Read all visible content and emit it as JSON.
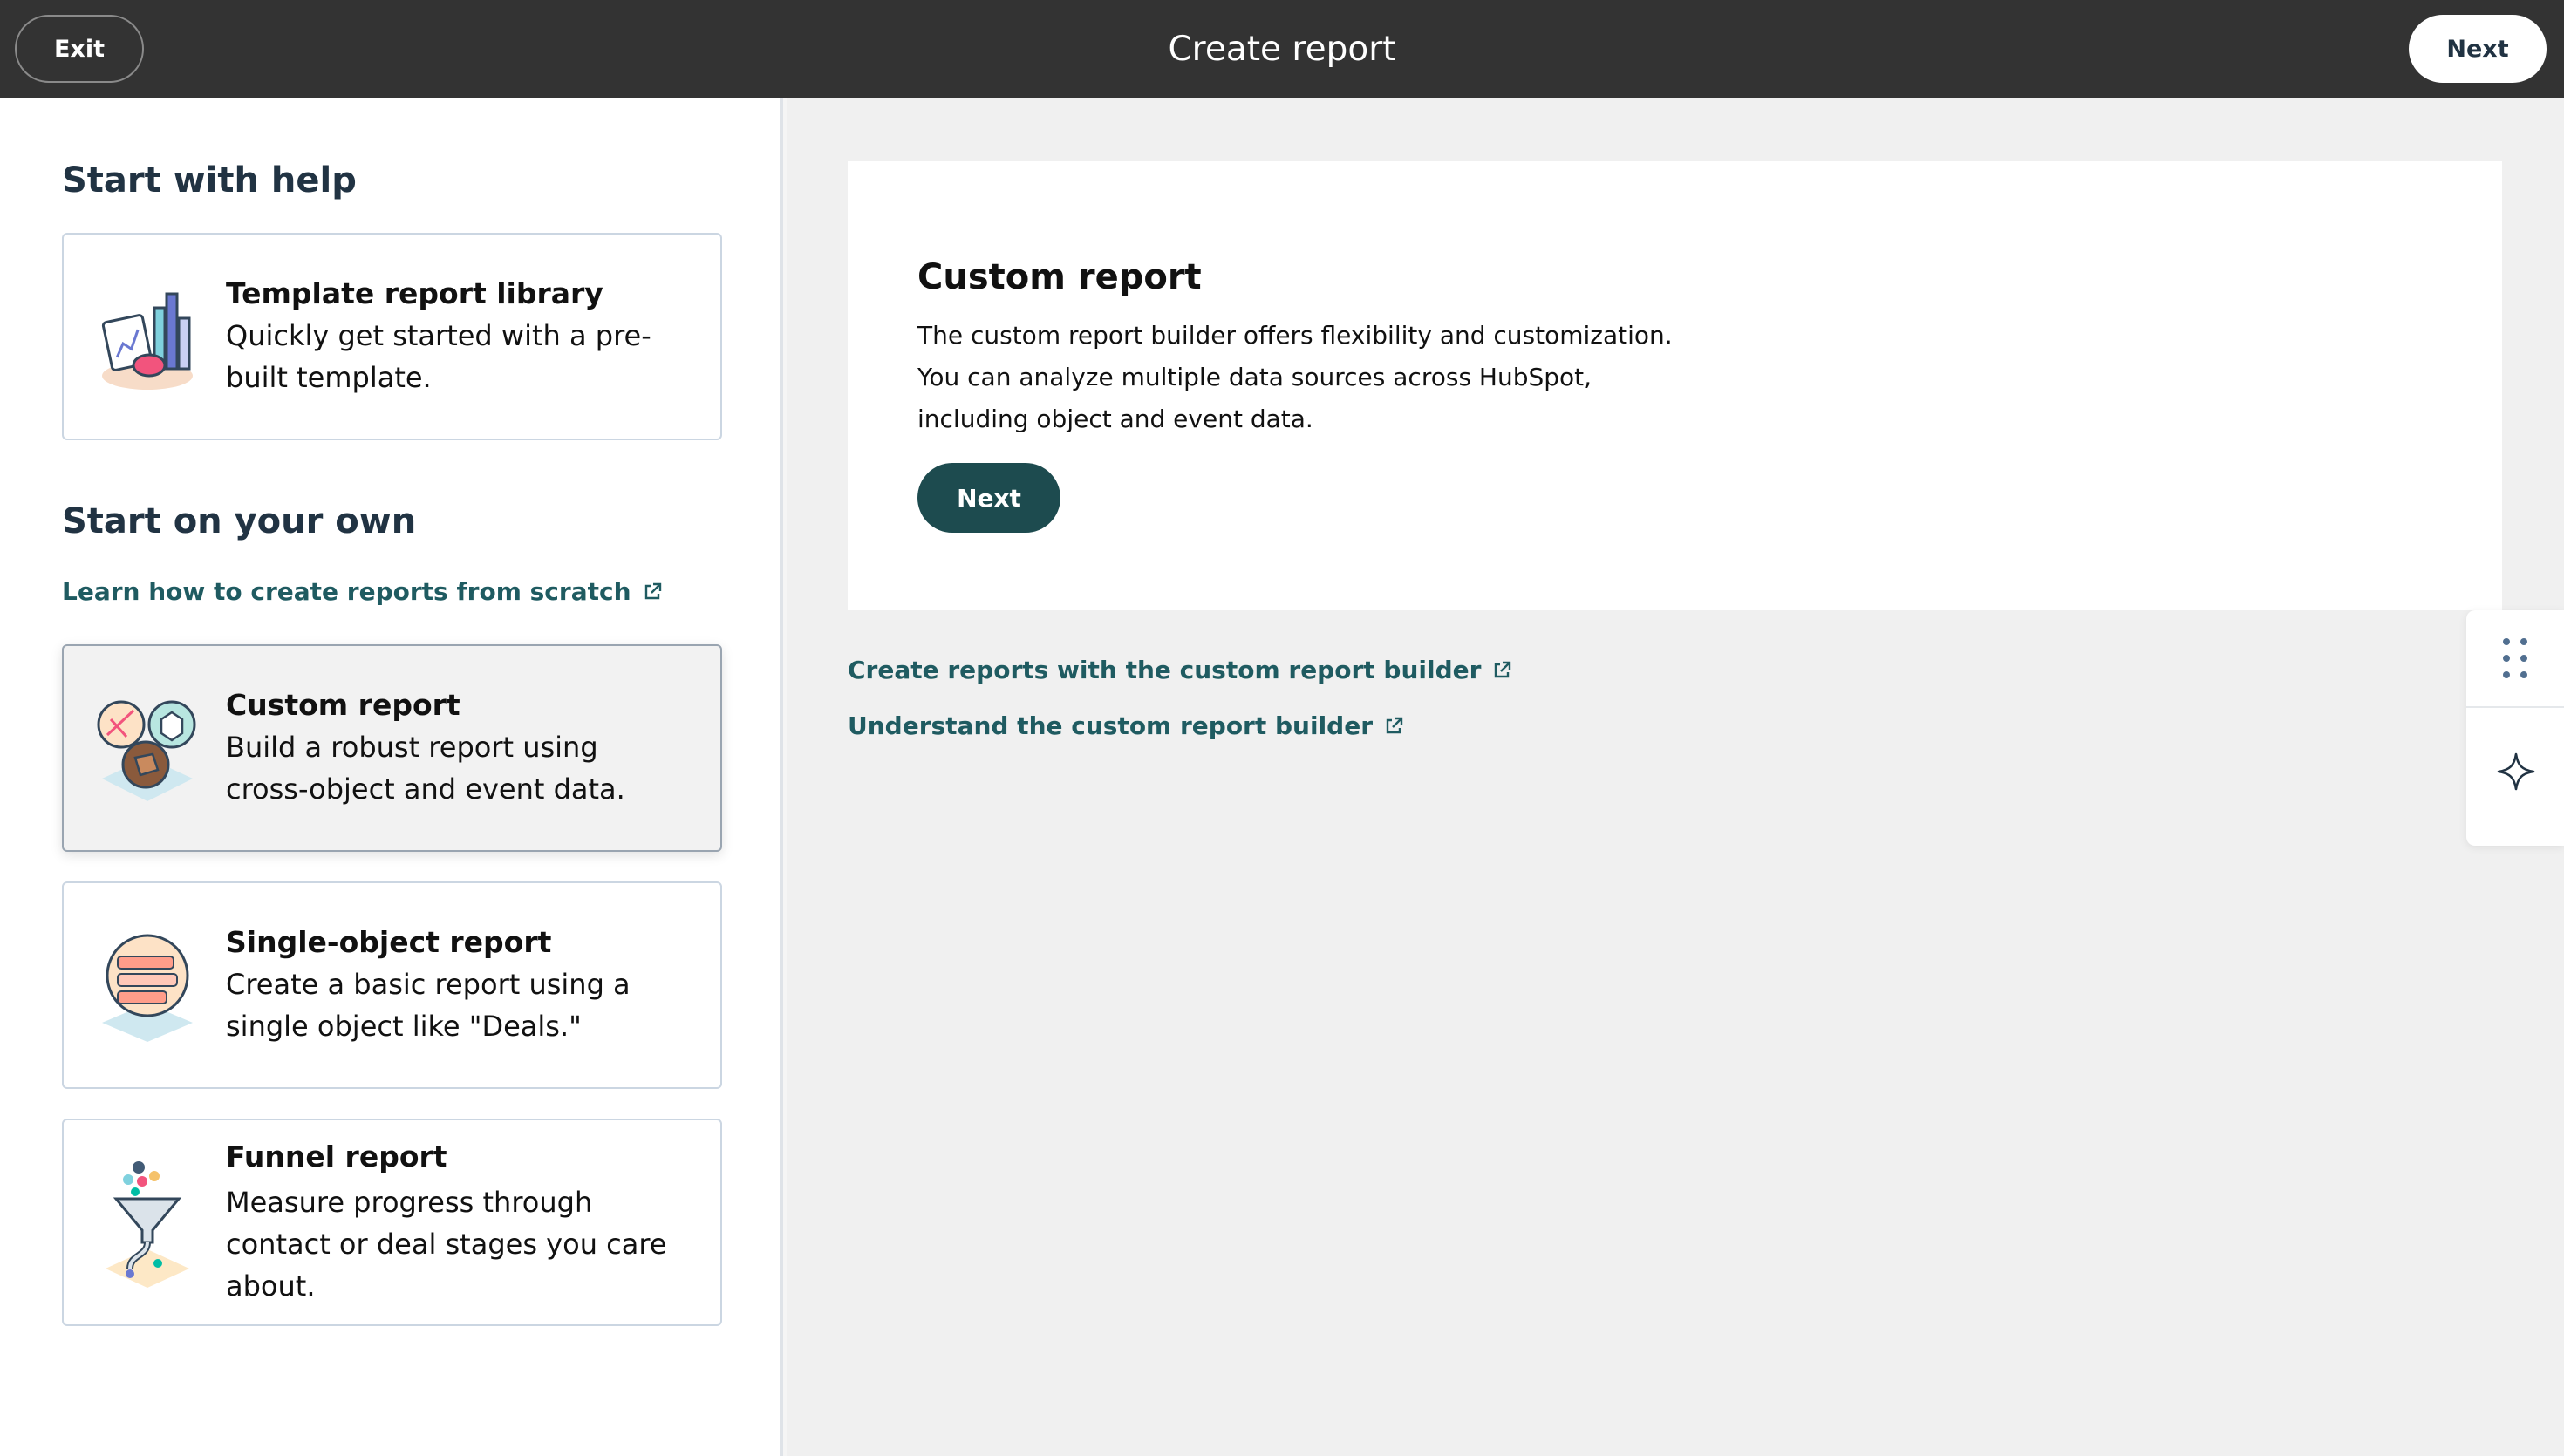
{
  "header": {
    "exit_label": "Exit",
    "title": "Create report",
    "next_label": "Next"
  },
  "left": {
    "help_title": "Start with help",
    "own_title": "Start on your own",
    "learn_link": "Learn how to create reports from scratch",
    "cards": [
      {
        "title": "Template report library",
        "description": "Quickly get started with a pre-built template.",
        "icon": "chart-library-icon"
      },
      {
        "title": "Custom report",
        "description": "Build a robust report using cross-object and event data.",
        "icon": "custom-report-icon",
        "selected": true
      },
      {
        "title": "Single-object report",
        "description": "Create a basic report using a single object like \"Deals.\"",
        "icon": "single-object-icon"
      },
      {
        "title": "Funnel report",
        "description": "Measure progress through contact or deal stages you care about.",
        "icon": "funnel-icon"
      }
    ]
  },
  "detail": {
    "title": "Custom report",
    "description": "The custom report builder offers flexibility and customization. You can analyze multiple data sources across HubSpot, including object and event data.",
    "next_label": "Next"
  },
  "right_links": {
    "builder_link": "Create reports with the custom report builder",
    "understand_link": "Understand the custom report builder"
  },
  "colors": {
    "header_bg": "#333333",
    "primary_button": "#1d4b4f",
    "link": "#1f5b61"
  }
}
